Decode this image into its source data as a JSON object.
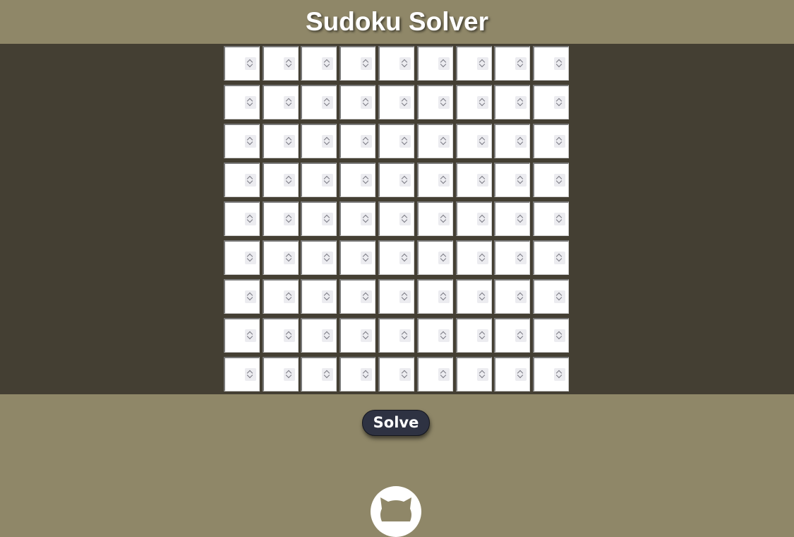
{
  "header": {
    "title": "Sudoku Solver"
  },
  "board": {
    "rows": 9,
    "cols": 9,
    "values": [
      [
        "",
        "",
        "",
        "",
        "",
        "",
        "",
        "",
        ""
      ],
      [
        "",
        "",
        "",
        "",
        "",
        "",
        "",
        "",
        ""
      ],
      [
        "",
        "",
        "",
        "",
        "",
        "",
        "",
        "",
        ""
      ],
      [
        "",
        "",
        "",
        "",
        "",
        "",
        "",
        "",
        ""
      ],
      [
        "",
        "",
        "",
        "",
        "",
        "",
        "",
        "",
        ""
      ],
      [
        "",
        "",
        "",
        "",
        "",
        "",
        "",
        "",
        ""
      ],
      [
        "",
        "",
        "",
        "",
        "",
        "",
        "",
        "",
        ""
      ],
      [
        "",
        "",
        "",
        "",
        "",
        "",
        "",
        "",
        ""
      ],
      [
        "",
        "",
        "",
        "",
        "",
        "",
        "",
        "",
        ""
      ]
    ]
  },
  "actions": {
    "solve_label": "Solve"
  },
  "footer": {
    "icon": "github-icon"
  },
  "colors": {
    "background": "#8f8768",
    "board_band": "#443f33",
    "button": "#2e3242",
    "title_text": "#ffffff"
  }
}
